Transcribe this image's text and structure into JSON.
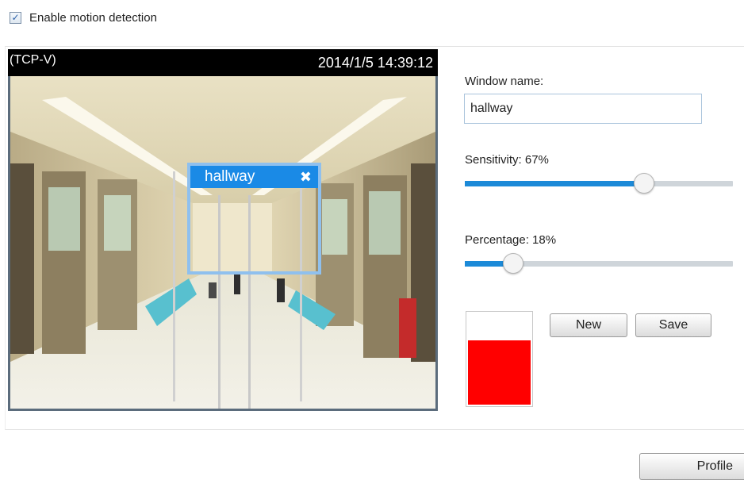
{
  "motion": {
    "enable_label": "Enable motion detection",
    "enabled": true
  },
  "video": {
    "stream_label": "(TCP-V)",
    "timestamp": "2014/1/5 14:39:12"
  },
  "motion_window": {
    "name": "hallway"
  },
  "settings": {
    "window_name_label": "Window name:",
    "window_name_value": "hallway",
    "sensitivity_label": "Sensitivity: 67%",
    "sensitivity_value": 67,
    "percentage_label": "Percentage: 18%",
    "percentage_value": 18,
    "activity_level": 0.7
  },
  "buttons": {
    "new": "New",
    "save": "Save",
    "profile": "Profile"
  },
  "colors": {
    "accent": "#1c8ad8",
    "window_border": "#8fc0ee",
    "window_title": "#1a8ae6",
    "activity": "#ff0000"
  },
  "icons": {
    "checkbox": "checkmark-icon",
    "close": "close-x-icon"
  }
}
